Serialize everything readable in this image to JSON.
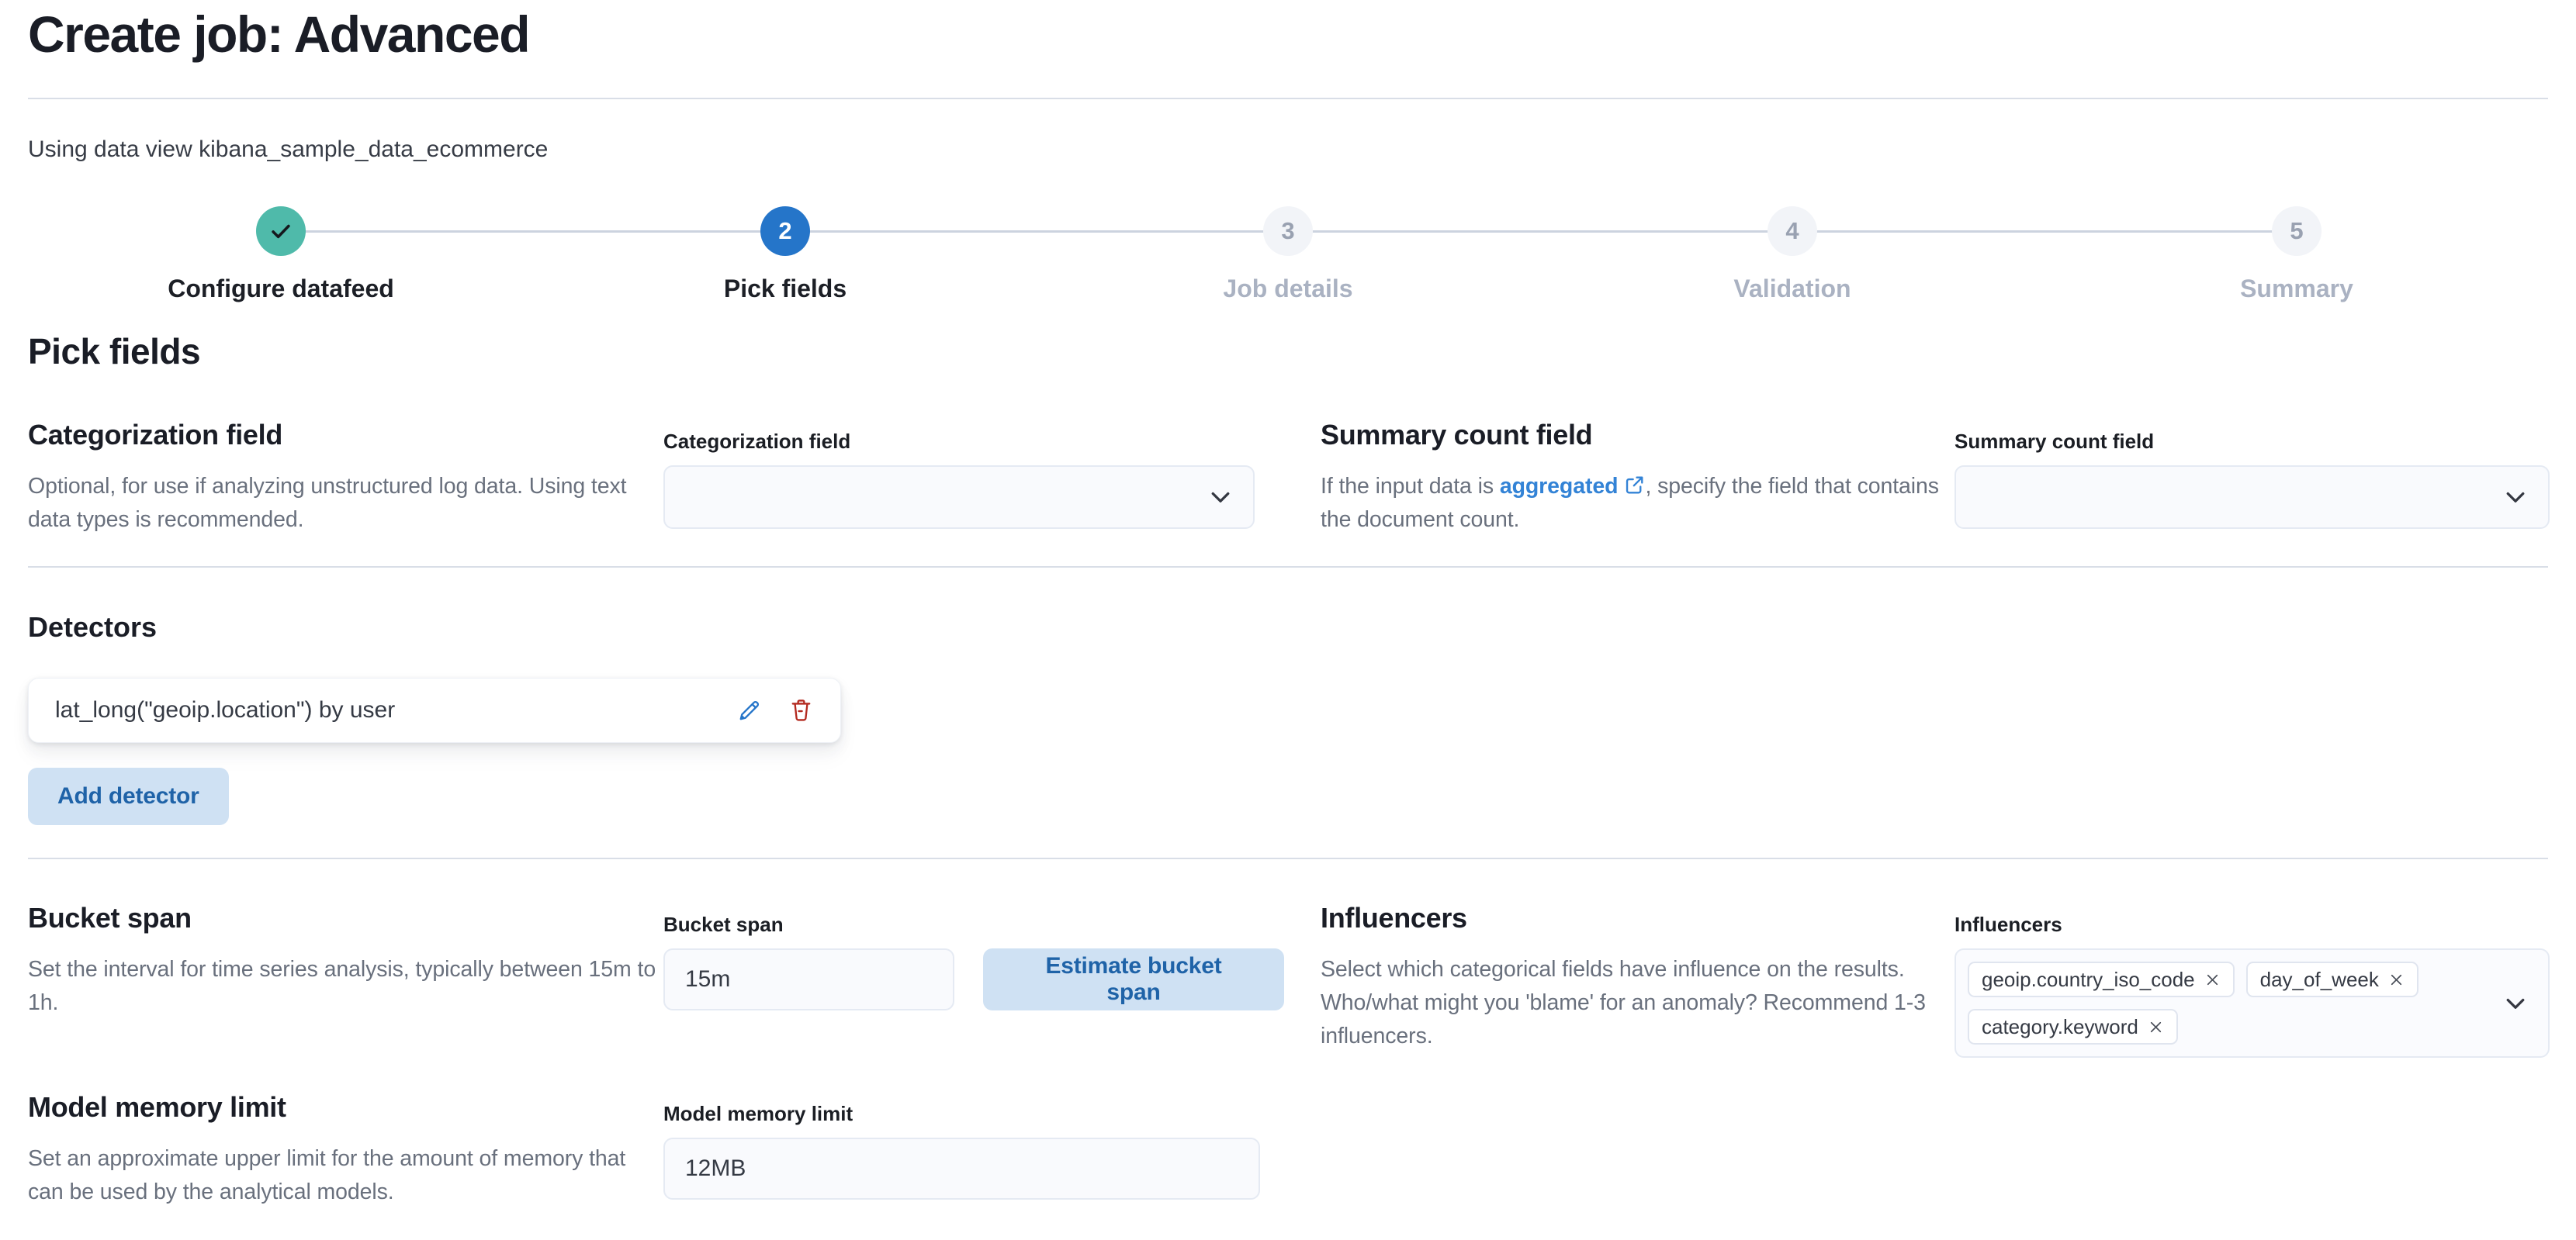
{
  "header": {
    "title": "Create job: Advanced",
    "data_view_note": "Using data view kibana_sample_data_ecommerce"
  },
  "stepper": {
    "steps": [
      {
        "label": "Configure datafeed",
        "status": "complete"
      },
      {
        "label": "Pick fields",
        "number": "2",
        "status": "current"
      },
      {
        "label": "Job details",
        "number": "3",
        "status": "incomplete"
      },
      {
        "label": "Validation",
        "number": "4",
        "status": "incomplete"
      },
      {
        "label": "Summary",
        "number": "5",
        "status": "incomplete"
      }
    ]
  },
  "section": {
    "title": "Pick fields"
  },
  "categorization": {
    "heading": "Categorization field",
    "description": "Optional, for use if analyzing unstructured log data. Using text data types is recommended.",
    "field_label": "Categorization field",
    "value": ""
  },
  "summary_count": {
    "heading": "Summary count field",
    "description_prefix": "If the input data is ",
    "link_text": "aggregated",
    "description_suffix": ", specify the field that contains the document count.",
    "field_label": "Summary count field",
    "value": ""
  },
  "detectors": {
    "heading": "Detectors",
    "items": [
      {
        "text": "lat_long(\"geoip.location\") by user"
      }
    ],
    "add_button": "Add detector"
  },
  "bucket_span": {
    "heading": "Bucket span",
    "description": "Set the interval for time series analysis, typically between 15m to 1h.",
    "field_label": "Bucket span",
    "value": "15m",
    "estimate_button": "Estimate bucket span"
  },
  "influencers": {
    "heading": "Influencers",
    "description": "Select which categorical fields have influence on the results. Who/what might you 'blame' for an anomaly? Recommend 1-3 influencers.",
    "field_label": "Influencers",
    "selected": [
      "geoip.country_iso_code",
      "day_of_week",
      "category.keyword"
    ]
  },
  "model_memory_limit": {
    "heading": "Model memory limit",
    "description": "Set an approximate upper limit for the amount of memory that can be used by the analytical models.",
    "field_label": "Model memory limit",
    "value": "12MB"
  },
  "colors": {
    "primary_blue": "#2575c9",
    "link_blue": "#3383d6",
    "success_teal": "#4fbaaa",
    "danger_red": "#b3291f",
    "soft_button_bg": "#cfe1f3",
    "soft_button_text": "#1f63a8",
    "divider": "#d9dee7",
    "field_bg": "#f9fafd",
    "field_border": "#e5eaf3",
    "muted_text": "#69707d",
    "disabled_step_text": "#aab2c2"
  }
}
